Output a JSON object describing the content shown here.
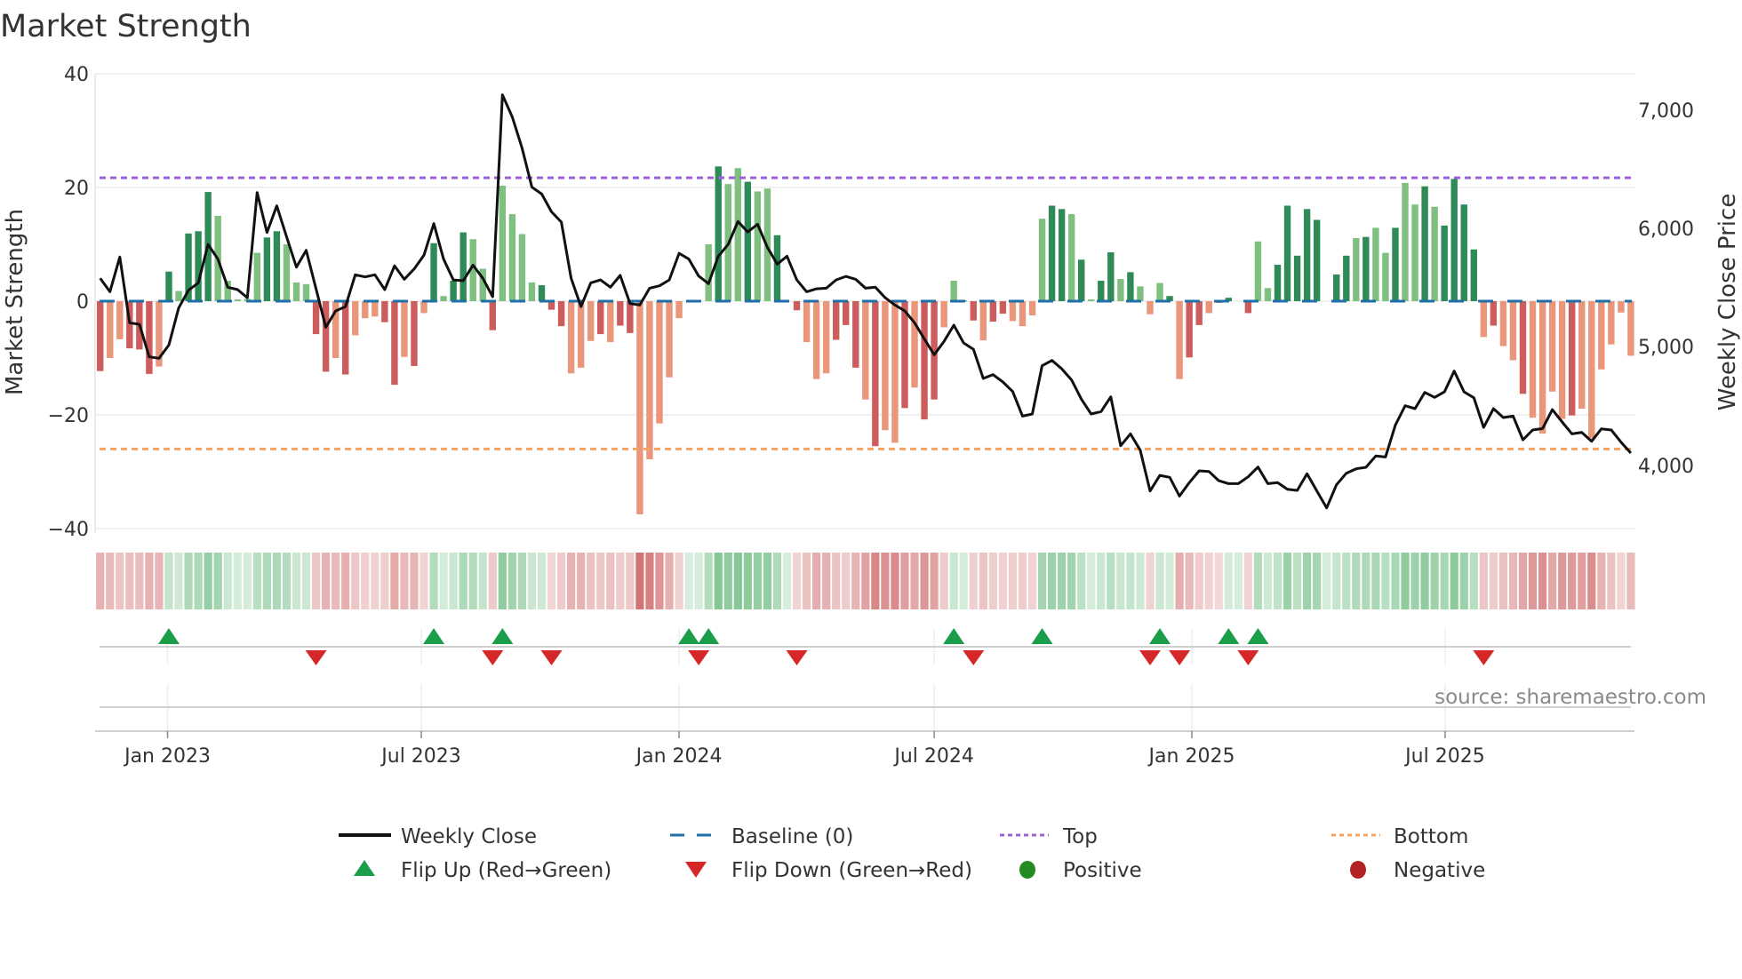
{
  "chart_data": {
    "type": "bar",
    "title": "Market Strength",
    "ylabel": "Market Strength",
    "y2label": "Weekly Close Price",
    "ylim": [
      -40,
      40
    ],
    "y2lim": [
      3459,
      7307
    ],
    "yticks": [
      "40",
      "20",
      "0",
      "−20",
      "−40"
    ],
    "ytick_values": [
      40,
      20,
      0,
      -20,
      -40
    ],
    "y2ticks": [
      "7,000",
      "6,000",
      "5,000",
      "4,000"
    ],
    "y2tick_values": [
      7000,
      6000,
      5000,
      4000
    ],
    "xticks": [
      {
        "label": "Jan 2023",
        "week": 6.87
      },
      {
        "label": "Jul 2023",
        "week": 32.73
      },
      {
        "label": "Jan 2024",
        "week": 59.0
      },
      {
        "label": "Jul 2024",
        "week": 85.0
      },
      {
        "label": "Jan 2025",
        "week": 111.26
      },
      {
        "label": "Jul 2025",
        "week": 137.07
      }
    ],
    "top_level": 21.7,
    "bottom_level": -26,
    "baseline": 0,
    "strength": [
      -12.3,
      -10,
      -6.7,
      -8.3,
      -8.5,
      -12.8,
      -11.5,
      5.2,
      1.8,
      11.9,
      12.3,
      19.2,
      15,
      3.6,
      0.3,
      0.4,
      8.5,
      11.2,
      12.3,
      10,
      3.3,
      3,
      -5.8,
      -12.4,
      -10,
      -12.9,
      -6,
      -3,
      -2.7,
      -3.7,
      -14.7,
      -9.8,
      -11.4,
      -2.1,
      10.2,
      0.9,
      3.6,
      12.1,
      10.9,
      5.7,
      -5.1,
      20.3,
      15.3,
      11.8,
      3.3,
      2.8,
      -1.5,
      -4.4,
      -12.7,
      -11.7,
      -7,
      -5.8,
      -7.2,
      -4.3,
      -5.6,
      -37.5,
      -27.8,
      -21.5,
      -13.4,
      -3,
      0,
      0,
      10,
      23.7,
      20.6,
      23.4,
      21,
      19.3,
      19.8,
      11.6,
      0,
      -1.6,
      -7.2,
      -13.7,
      -12.7,
      -6.8,
      -4.2,
      -11.7,
      -17.3,
      -25.5,
      -22.7,
      -24.9,
      -18.8,
      -15.2,
      -20.8,
      -17.3,
      -4.6,
      3.6,
      0.1,
      -3.4,
      -6.9,
      -3.6,
      -2.2,
      -3.5,
      -4.4,
      -2.5,
      14.5,
      16.8,
      16.2,
      15.3,
      7.3,
      0.3,
      3.6,
      8.6,
      3.9,
      5.1,
      2.6,
      -2.3,
      3.2,
      0.9,
      -13.7,
      -9.9,
      -4.2,
      -2.1,
      -0.3,
      0.6,
      0,
      -2.1,
      10.5,
      2.3,
      6.4,
      16.8,
      8,
      16.2,
      14.3,
      0,
      4.7,
      8,
      11.1,
      11.3,
      12.9,
      8.5,
      12.9,
      20.8,
      17,
      20.2,
      16.6,
      13.3,
      21.5,
      17,
      9.1,
      -6.3,
      -4.3,
      -7.9,
      -10.4,
      -16.3,
      -20.5,
      -23.3,
      -15.9,
      -20.7,
      -20.1,
      -18.9,
      -24.1,
      -12,
      -7.6,
      -2,
      -9.6
    ],
    "shade": "dlldddldldddlllllddlllddldlllddldldlddlldlllldddllldlddlllllldldlldlldddllldddldlldlddllddldd llllddldlddldllldlddlddldlldddddlddldlldlldlddddldlldlllld",
    "weekly_close": [
      5580,
      5467,
      5760,
      5205,
      5192,
      4917,
      4905,
      5017,
      5330,
      5480,
      5542,
      5867,
      5742,
      5505,
      5485,
      5417,
      6305,
      5967,
      6192,
      5930,
      5675,
      5817,
      5492,
      5167,
      5305,
      5342,
      5610,
      5592,
      5610,
      5485,
      5685,
      5572,
      5660,
      5775,
      6042,
      5742,
      5567,
      5560,
      5692,
      5580,
      5425,
      7130,
      6942,
      6680,
      6350,
      6292,
      6142,
      6055,
      5580,
      5342,
      5542,
      5567,
      5505,
      5605,
      5367,
      5355,
      5497,
      5517,
      5567,
      5792,
      5742,
      5600,
      5535,
      5767,
      5867,
      6060,
      5972,
      6037,
      5842,
      5700,
      5767,
      5567,
      5467,
      5492,
      5497,
      5567,
      5597,
      5572,
      5497,
      5505,
      5417,
      5355,
      5305,
      5205,
      5067,
      4935,
      5047,
      5185,
      5035,
      4980,
      4735,
      4767,
      4705,
      4625,
      4417,
      4435,
      4842,
      4887,
      4817,
      4722,
      4560,
      4435,
      4455,
      4580,
      4167,
      4267,
      4130,
      3785,
      3917,
      3900,
      3742,
      3855,
      3955,
      3950,
      3872,
      3847,
      3847,
      3905,
      3987,
      3847,
      3855,
      3800,
      3790,
      3930,
      3785,
      3642,
      3837,
      3935,
      3972,
      3985,
      4080,
      4072,
      4342,
      4505,
      4480,
      4617,
      4575,
      4622,
      4797,
      4622,
      4572,
      4322,
      4480,
      4405,
      4417,
      4217,
      4300,
      4312,
      4472,
      4367,
      4267,
      4280,
      4205,
      4310,
      4300,
      4197,
      4105
    ],
    "flip_up_weeks": [
      7,
      34,
      41,
      60,
      62,
      87,
      96,
      108,
      115,
      118
    ],
    "flip_down_weeks": [
      22,
      40,
      46,
      61,
      71,
      89,
      107,
      110,
      117,
      141
    ],
    "legend": [
      {
        "label": "Weekly Close",
        "type": "line"
      },
      {
        "label": "Baseline (0)",
        "type": "dashed"
      },
      {
        "label": "Top",
        "type": "dotted"
      },
      {
        "label": "Bottom",
        "type": "dotted"
      },
      {
        "label": "Flip Up (Red→Green)",
        "type": "triangle-up"
      },
      {
        "label": "Flip Down (Green→Red)",
        "type": "triangle-down"
      },
      {
        "label": "Positive",
        "type": "dot"
      },
      {
        "label": "Negative",
        "type": "dot"
      }
    ],
    "legend_position": "bottom",
    "source": "source: sharemaestro.com",
    "colors": {
      "pos_strong": "#2e8b57",
      "pos_weak": "#7fbf7f",
      "neg_strong": "#cd5c5c",
      "neg_weak": "#e9967a",
      "line": "#111111",
      "baseline": "#1f6fa8",
      "top": "#9b5fd6",
      "bottom": "#f4a460",
      "flip_up": "#1a9e4a",
      "flip_down": "#d62728",
      "positive": "#228b22",
      "negative": "#b22222"
    }
  }
}
